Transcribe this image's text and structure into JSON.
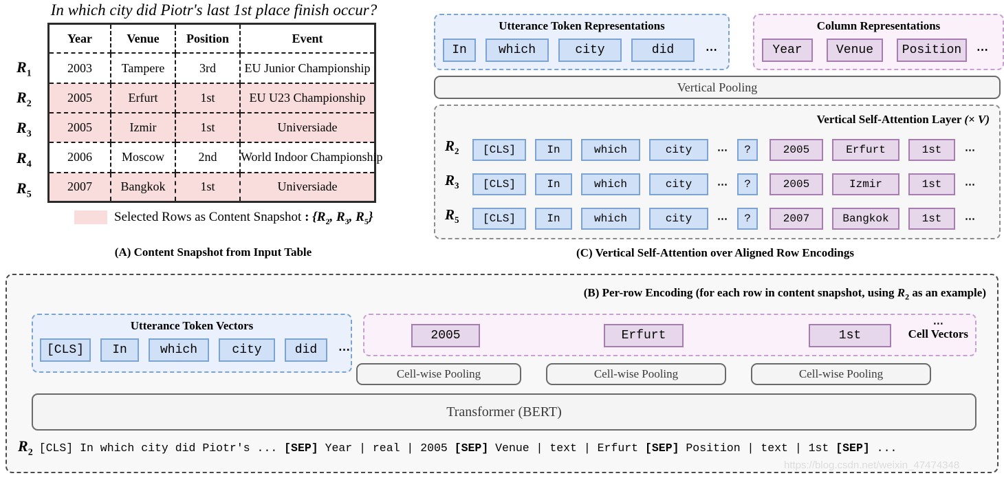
{
  "panel_a": {
    "question": "In which city did Piotr's last 1st place finish occur?",
    "row_labels": [
      "R1",
      "R2",
      "R3",
      "R4",
      "R5"
    ],
    "columns": [
      "Year",
      "Venue",
      "Position",
      "Event"
    ],
    "rows": [
      {
        "label": "R1",
        "highlighted": false,
        "cells": [
          "2003",
          "Tampere",
          "3rd",
          "EU Junior Championship"
        ]
      },
      {
        "label": "R2",
        "highlighted": true,
        "cells": [
          "2005",
          "Erfurt",
          "1st",
          "EU U23 Championship"
        ]
      },
      {
        "label": "R3",
        "highlighted": true,
        "cells": [
          "2005",
          "Izmir",
          "1st",
          "Universiade"
        ]
      },
      {
        "label": "R4",
        "highlighted": false,
        "cells": [
          "2006",
          "Moscow",
          "2nd",
          "World Indoor Championship"
        ]
      },
      {
        "label": "R5",
        "highlighted": true,
        "cells": [
          "2007",
          "Bangkok",
          "1st",
          "Universiade"
        ]
      }
    ],
    "legend_text": "Selected Rows as Content Snapshot : {R2, R3, R5}",
    "caption": "(A) Content Snapshot from Input Table"
  },
  "panel_c": {
    "utterance_box": {
      "title": "Utterance Token Representations",
      "tokens": [
        "In",
        "which",
        "city",
        "did"
      ],
      "ellipsis": "⋯"
    },
    "column_box": {
      "title": "Column Representations",
      "tokens": [
        "Year",
        "Venue",
        "Position"
      ],
      "ellipsis": "⋯"
    },
    "vertical_pooling_label": "Vertical Pooling",
    "vsa_title": "Vertical Self-Attention Layer",
    "vsa_multiplier": "(× V)",
    "rows": [
      {
        "label": "R2",
        "utterance": [
          "[CLS]",
          "In",
          "which",
          "city"
        ],
        "gap_dots": "⋯",
        "q": "?",
        "cells": [
          "2005",
          "Erfurt",
          "1st"
        ],
        "tail_dots": "⋯"
      },
      {
        "label": "R3",
        "utterance": [
          "[CLS]",
          "In",
          "which",
          "city"
        ],
        "gap_dots": "⋯",
        "q": "?",
        "cells": [
          "2005",
          "Izmir",
          "1st"
        ],
        "tail_dots": "⋯"
      },
      {
        "label": "R5",
        "utterance": [
          "[CLS]",
          "In",
          "which",
          "city"
        ],
        "gap_dots": "⋯",
        "q": "?",
        "cells": [
          "2007",
          "Bangkok",
          "1st"
        ],
        "tail_dots": "⋯"
      }
    ],
    "caption": "(C) Vertical Self-Attention over Aligned Row Encodings"
  },
  "panel_b": {
    "caption": "(B) Per-row Encoding (for each row in content snapshot, using R2 as an example)",
    "caption_prefix": "(B) Per-row Encoding (for each row in content snapshot, using ",
    "caption_var": "R",
    "caption_var_sub": "2",
    "caption_suffix": " as an example)",
    "utterance_box": {
      "title": "Utterance Token Vectors",
      "tokens": [
        "[CLS]",
        "In",
        "which",
        "city",
        "did"
      ],
      "ellipsis": "⋯"
    },
    "cell_vectors": {
      "label": "Cell Vectors",
      "label_dots": "⋯",
      "cells": [
        "2005",
        "Erfurt",
        "1st"
      ]
    },
    "pooling_label": "Cell-wise Pooling",
    "pooling_labels": [
      "Cell-wise Pooling",
      "Cell-wise Pooling",
      "Cell-wise Pooling"
    ],
    "transformer_label": "Transformer (BERT)",
    "sequence": {
      "row_label": "R",
      "row_label_sub": "2",
      "parts": [
        {
          "text": "[CLS] In which city did Piotr's ... ",
          "bold": false
        },
        {
          "text": "[SEP]",
          "bold": true
        },
        {
          "text": " Year | real | 2005 ",
          "bold": false
        },
        {
          "text": "[SEP]",
          "bold": true
        },
        {
          "text": " Venue | text | Erfurt ",
          "bold": false
        },
        {
          "text": "[SEP]",
          "bold": true
        },
        {
          "text": " Position | text | 1st ",
          "bold": false
        },
        {
          "text": "[SEP]",
          "bold": true
        },
        {
          "text": " ...",
          "bold": false
        }
      ],
      "full_text": "[CLS] In which city did Piotr's ... [SEP] Year | real | 2005 [SEP] Venue | text | Erfurt [SEP] Position | text | 1st [SEP] ..."
    }
  },
  "watermark": "https://blog.csdn.net/weixin_47474348",
  "colors": {
    "highlight_pink": "#f9dcdc",
    "blue_chip_fill": "#cfe0f7",
    "blue_chip_border": "#7ba3d4",
    "blue_panel_bg": "#eaf1fc",
    "purple_chip_fill": "#e7d7ea",
    "purple_chip_border": "#a77cb2",
    "purple_panel_bg": "#fbf1fb",
    "gray_bar_bg": "#f4f4f4",
    "gray_border": "#6a6a6a"
  }
}
